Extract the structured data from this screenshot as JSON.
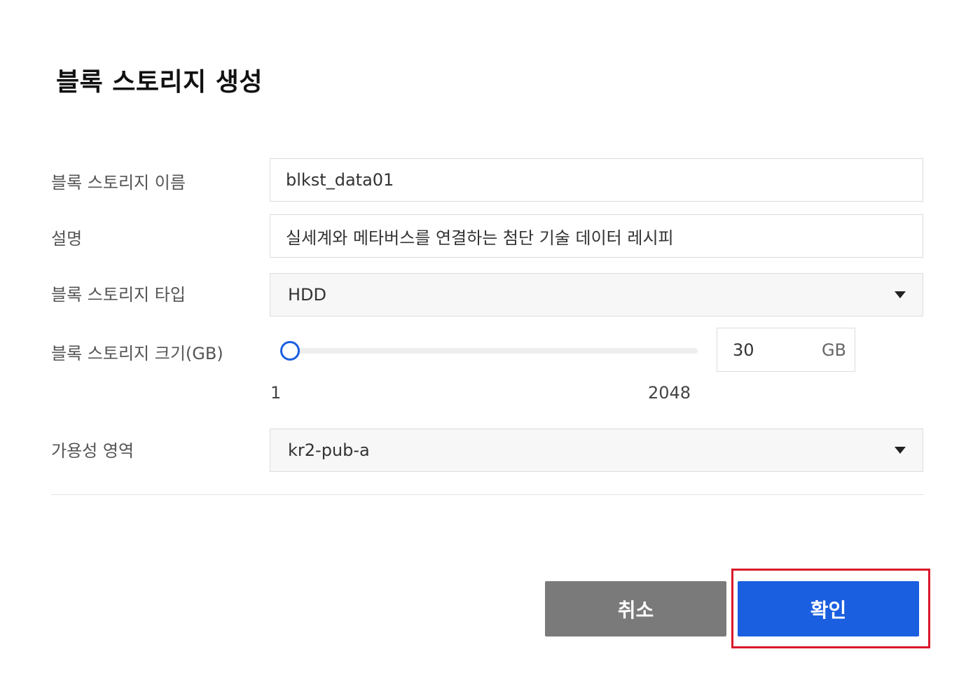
{
  "dialog": {
    "title": "블록 스토리지 생성"
  },
  "form": {
    "name_label": "블록 스토리지 이름",
    "name_value": "blkst_data01",
    "description_label": "설명",
    "description_value": "실세계와 메타버스를 연결하는 첨단 기술 데이터 레시피",
    "type_label": "블록 스토리지 타입",
    "type_value": "HDD",
    "size_label": "블록 스토리지 크기(GB)",
    "size_value": "30",
    "size_unit": "GB",
    "size_min": "1",
    "size_max": "2048",
    "zone_label": "가용성 영역",
    "zone_value": "kr2-pub-a"
  },
  "buttons": {
    "cancel_label": "취소",
    "confirm_label": "확인"
  },
  "colors": {
    "primary": "#1a5fe0",
    "cancel": "#7a7a7a",
    "highlight": "#d9192b"
  }
}
